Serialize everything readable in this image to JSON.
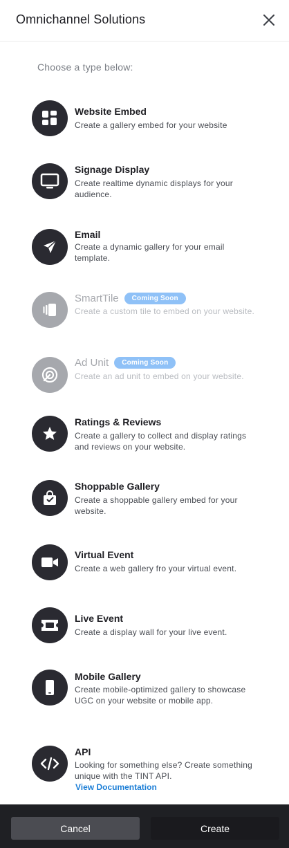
{
  "header": {
    "title": "Omnichannel Solutions"
  },
  "prompt": "Choose a type below:",
  "items": [
    {
      "title": "Website Embed",
      "desc": "Create a gallery embed for your website",
      "icon": "grid-icon"
    },
    {
      "title": "Signage Display",
      "desc": "Create realtime dynamic displays for your audience.",
      "icon": "monitor-icon"
    },
    {
      "title": "Email",
      "desc": "Create a dynamic gallery for your email template.",
      "icon": "paper-plane-icon"
    },
    {
      "title": "SmartTile",
      "badge": "Coming Soon",
      "desc": "Create a custom tile to embed on your website.",
      "icon": "tile-icon"
    },
    {
      "title": "Ad Unit",
      "badge": "Coming Soon",
      "desc": "Create an ad unit to embed on your website.",
      "icon": "target-icon"
    },
    {
      "title": "Ratings & Reviews",
      "desc": "Create a gallery to collect and display ratings and reviews on your website.",
      "icon": "star-icon"
    },
    {
      "title": "Shoppable Gallery",
      "desc": "Create a shoppable gallery embed for your website.",
      "icon": "shopping-bag-icon"
    },
    {
      "title": "Virtual Event",
      "desc": "Create a web gallery fro your virtual event.",
      "icon": "video-camera-icon"
    },
    {
      "title": "Live Event",
      "desc": "Create a display wall for your live event.",
      "icon": "ticket-icon"
    },
    {
      "title": "Mobile Gallery",
      "desc": "Create mobile-optimized gallery to showcase UGC on your website or mobile app.",
      "icon": "mobile-icon"
    },
    {
      "title": "API",
      "desc": "Looking for something else? Create something unique with the TINT API.",
      "link": "View Documentation",
      "icon": "code-icon"
    }
  ],
  "footer": {
    "cancel_label": "Cancel",
    "create_label": "Create"
  },
  "colors": {
    "dark": "#2a2a31",
    "disabled": "#a6a8ad",
    "badge": "#8fc1f7",
    "link": "#1c7ed6",
    "footer": "#1f2024"
  }
}
